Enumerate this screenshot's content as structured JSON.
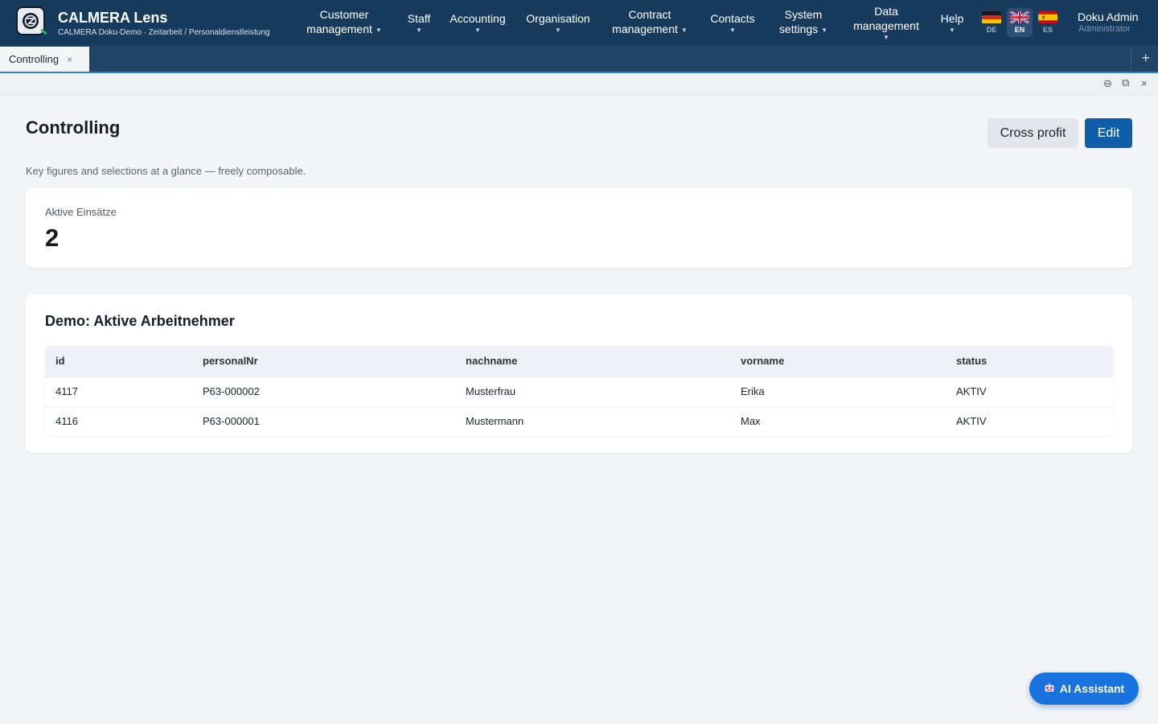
{
  "header": {
    "brand_name": "CALMERA Lens",
    "brand_sub": "CALMERA Doku-Demo · Zeitarbeit / Personaldienstleistung",
    "nav": [
      {
        "line1": "Customer",
        "line2": "management"
      },
      {
        "line1": "Staff",
        "line2": ""
      },
      {
        "line1": "Accounting",
        "line2": ""
      },
      {
        "line1": "Organisation",
        "line2": ""
      },
      {
        "line1": "Contract",
        "line2": "management"
      },
      {
        "line1": "Contacts",
        "line2": ""
      },
      {
        "line1": "System",
        "line2": "settings"
      },
      {
        "line1": "Data",
        "line2": "management"
      },
      {
        "line1": "Help",
        "line2": ""
      }
    ],
    "languages": [
      {
        "code": "DE"
      },
      {
        "code": "EN"
      },
      {
        "code": "ES"
      }
    ],
    "active_language": "EN",
    "user_name": "Doku Admin",
    "user_role": "Administrator"
  },
  "tabs": {
    "active_label": "Controlling",
    "close_glyph": "×",
    "add_glyph": "+"
  },
  "window_controls": {
    "minimize_glyph": "⊖",
    "restore_glyph": "⧉",
    "close_glyph": "×"
  },
  "page": {
    "title": "Controlling",
    "cross_profit_label": "Cross profit",
    "edit_label": "Edit",
    "description": "Key figures and selections at a glance — freely composable."
  },
  "kpi": {
    "label": "Aktive Einsätze",
    "value": "2"
  },
  "table": {
    "title": "Demo: Aktive Arbeitnehmer",
    "columns": [
      "id",
      "personalNr",
      "nachname",
      "vorname",
      "status"
    ],
    "rows": [
      [
        "4117",
        "P63-000002",
        "Musterfrau",
        "Erika",
        "AKTIV"
      ],
      [
        "4116",
        "P63-000001",
        "Mustermann",
        "Max",
        "AKTIV"
      ]
    ]
  },
  "ai_assistant": {
    "label": "AI Assistant"
  },
  "colors": {
    "header_bg": "#173b5c",
    "tabbar_bg": "#1f4364",
    "primary": "#0f5ea8",
    "ai_button": "#1873de",
    "page_bg": "#f3f5f8"
  }
}
